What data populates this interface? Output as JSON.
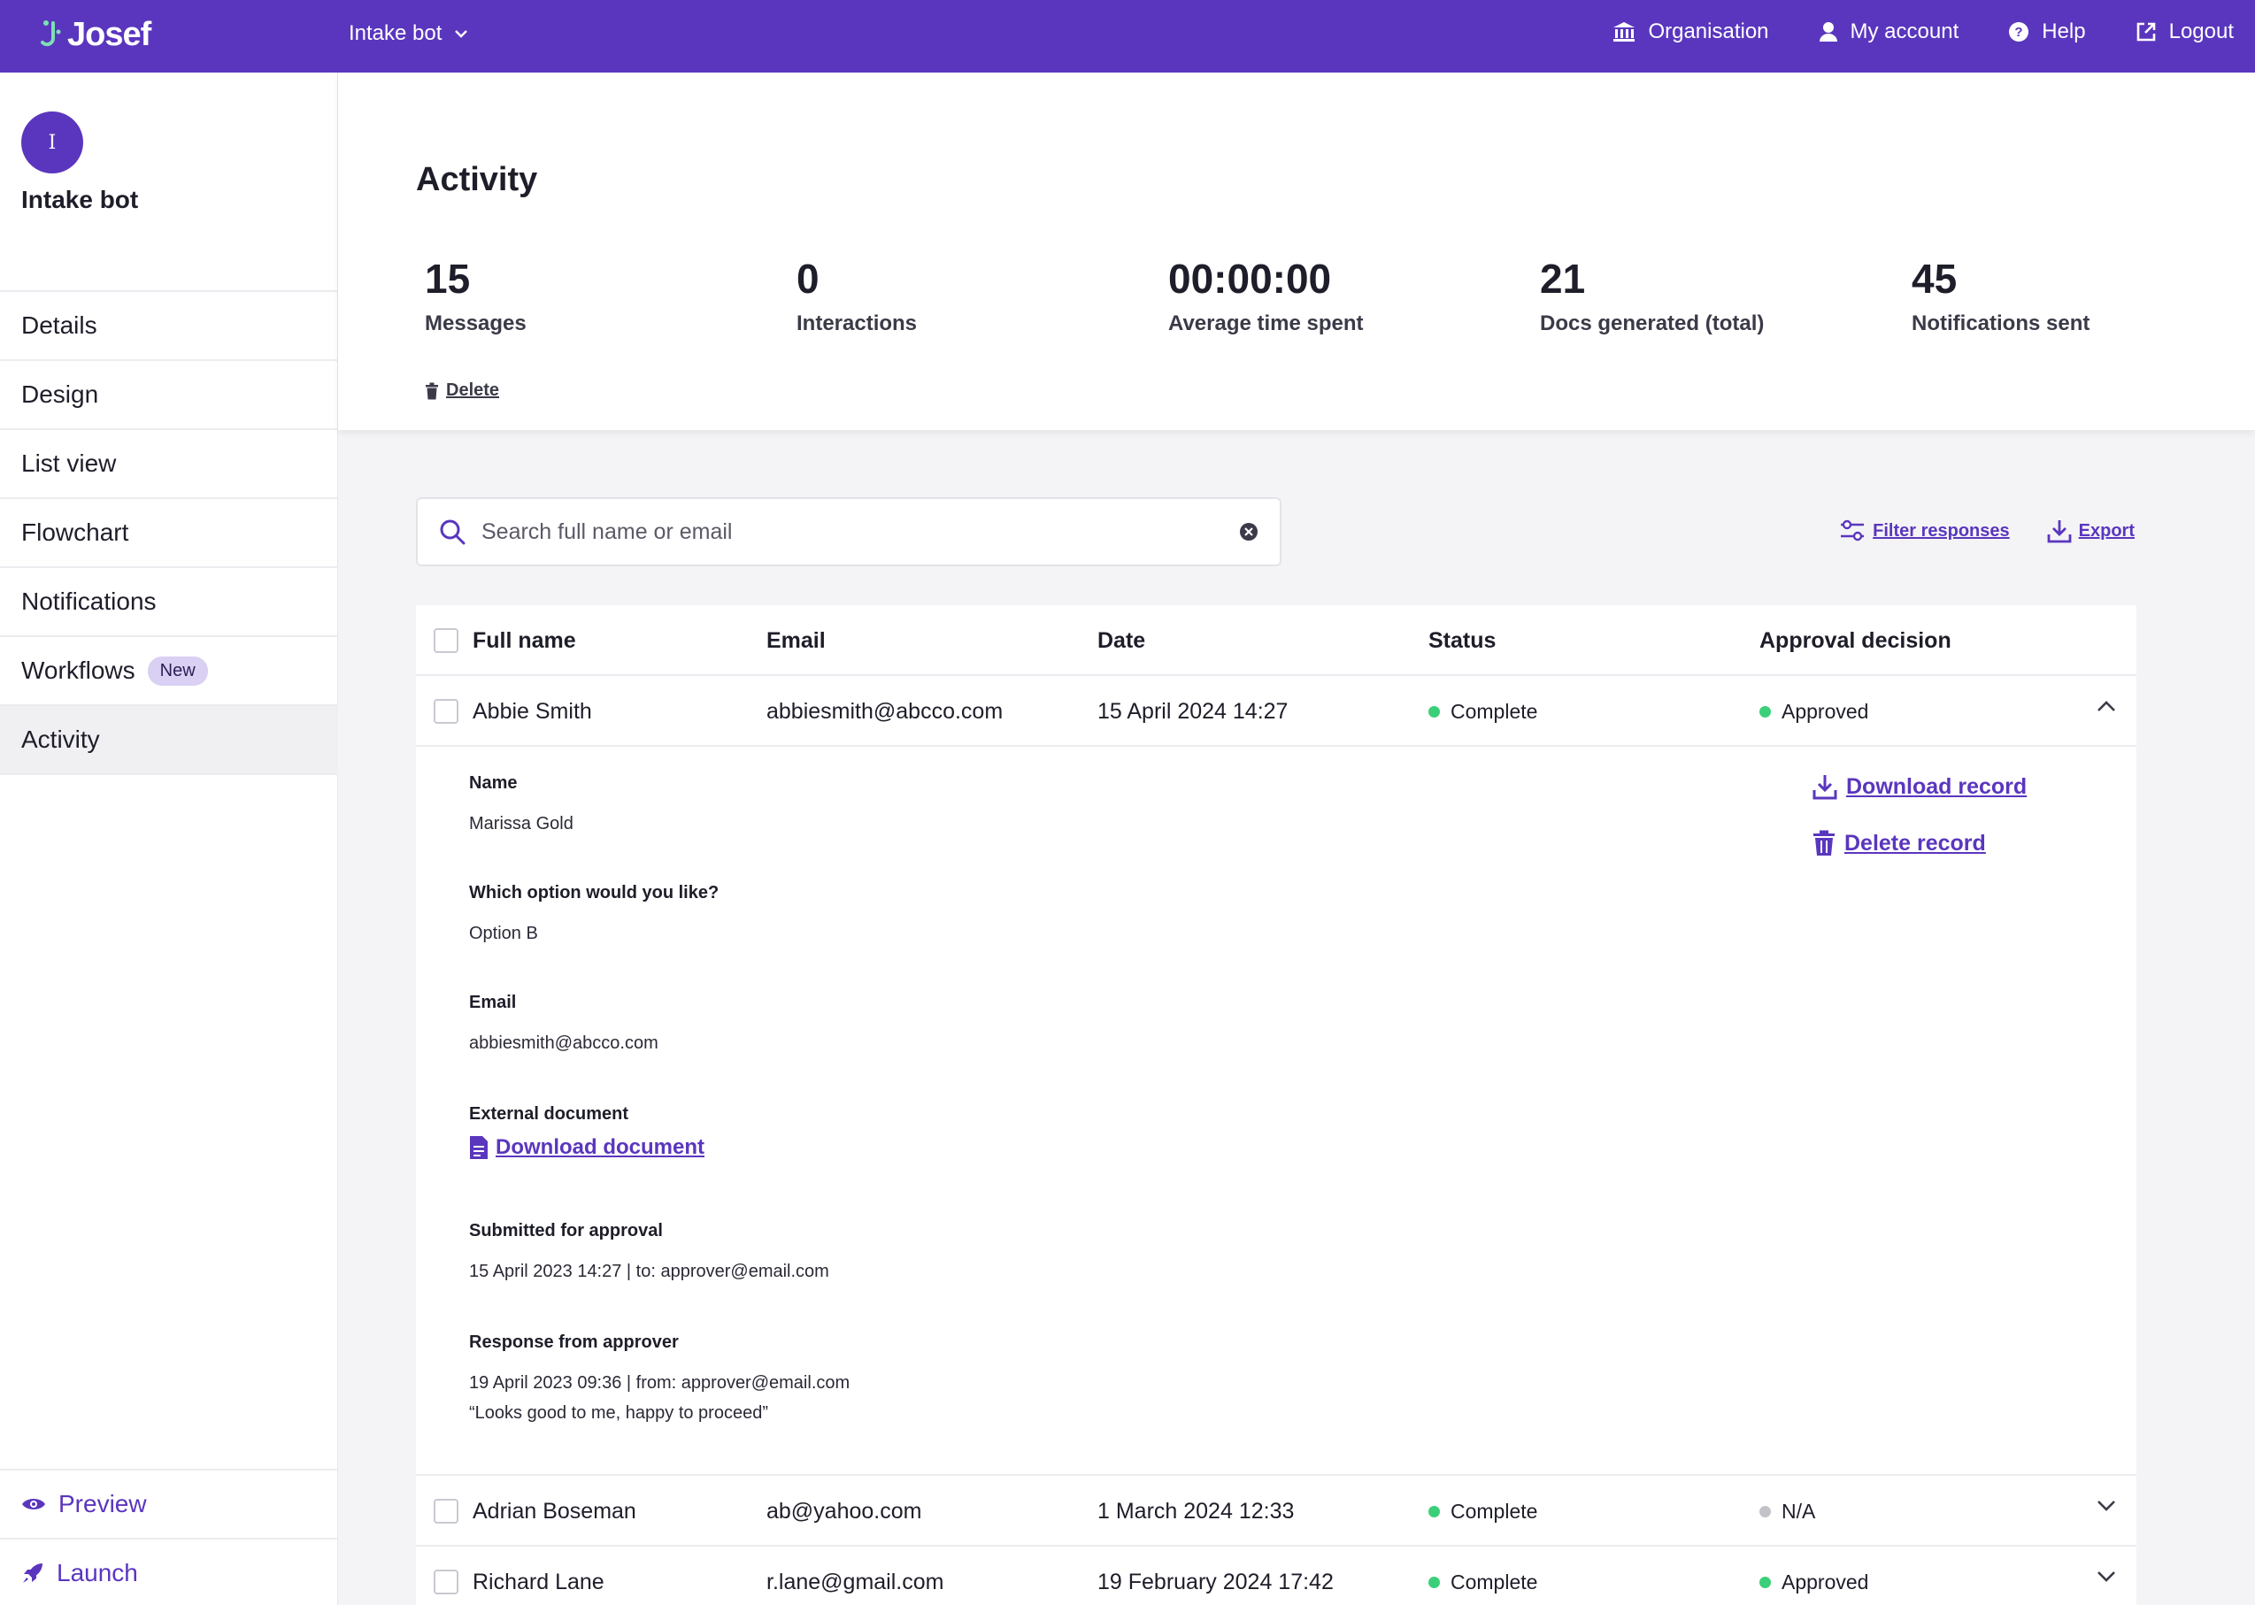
{
  "topbar": {
    "logo_text": "Josef",
    "bot_switcher": "Intake bot",
    "nav": {
      "organisation": "Organisation",
      "my_account": "My account",
      "help": "Help",
      "logout": "Logout"
    }
  },
  "sidebar": {
    "avatar_letter": "I",
    "bot_name": "Intake bot",
    "items": [
      {
        "label": "Details"
      },
      {
        "label": "Design"
      },
      {
        "label": "List view"
      },
      {
        "label": "Flowchart"
      },
      {
        "label": "Notifications"
      },
      {
        "label": "Workflows",
        "badge": "New"
      },
      {
        "label": "Activity",
        "active": true
      }
    ],
    "bottom": {
      "preview": "Preview",
      "launch": "Launch"
    }
  },
  "header": {
    "title": "Activity",
    "stats": [
      {
        "value": "15",
        "label": "Messages"
      },
      {
        "value": "0",
        "label": "Interactions"
      },
      {
        "value": "00:00:00",
        "label": "Average time spent"
      },
      {
        "value": "21",
        "label": "Docs generated (total)"
      },
      {
        "value": "45",
        "label": "Notifications sent"
      }
    ],
    "delete_label": "Delete"
  },
  "toolbar": {
    "search_placeholder": "Search full name or email",
    "filter_label": "Filter responses",
    "export_label": "Export"
  },
  "table": {
    "columns": {
      "full_name": "Full name",
      "email": "Email",
      "date": "Date",
      "status": "Status",
      "approval": "Approval decision"
    },
    "rows": [
      {
        "name": "Abbie Smith",
        "email": "abbiesmith@abcco.com",
        "date": "15 April 2024 14:27",
        "status": "Complete",
        "approval": "Approved"
      },
      {
        "name": "Adrian Boseman",
        "email": "ab@yahoo.com",
        "date": "1 March 2024 12:33",
        "status": "Complete",
        "approval": "N/A"
      },
      {
        "name": "Richard Lane",
        "email": "r.lane@gmail.com",
        "date": "19 February 2024 17:42",
        "status": "Complete",
        "approval": "Approved"
      }
    ],
    "detail": {
      "name_label": "Name",
      "name_value": "Marissa Gold",
      "option_label": "Which option would you like?",
      "option_value": "Option B",
      "email_label": "Email",
      "email_value": "abbiesmith@abcco.com",
      "ext_doc_label": "External document",
      "ext_doc_link": "Download document",
      "submitted_label": "Submitted for approval",
      "submitted_value": "15 April 2023 14:27 | to: approver@email.com",
      "response_label": "Response from approver",
      "response_value": "19 April 2023 09:36 | from: approver@email.com",
      "response_quote": "“Looks good to me, happy to proceed”",
      "download_record": "Download record",
      "delete_record": "Delete record"
    }
  },
  "colors": {
    "brand": "#5a36be",
    "status_green": "#3bcf7a",
    "status_grey": "#c2c2c8"
  }
}
